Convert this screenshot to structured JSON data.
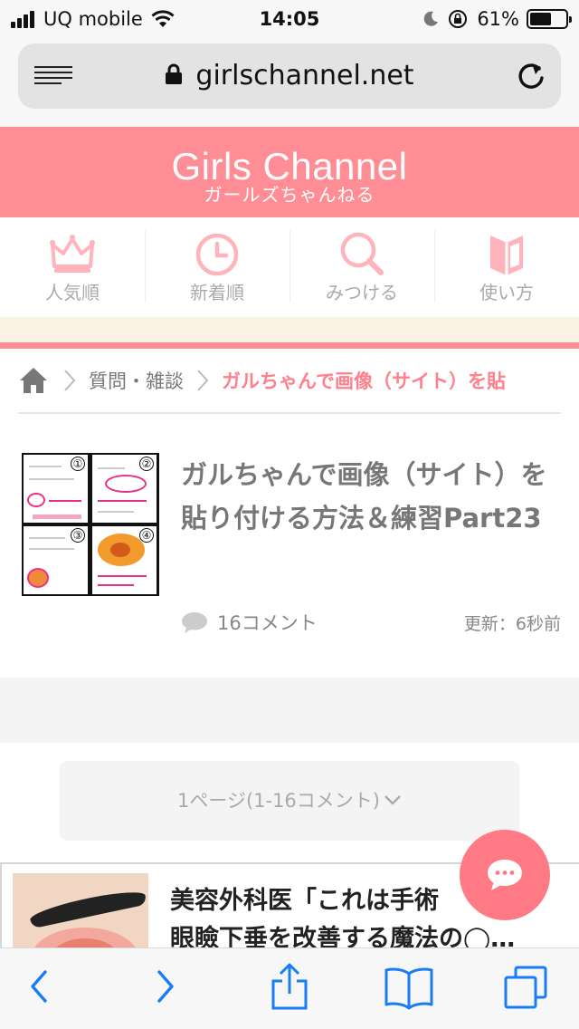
{
  "status_bar": {
    "carrier": "UQ mobile",
    "time": "14:05",
    "battery": "61%",
    "battery_level": 0.61
  },
  "browser": {
    "url": "girlschannel.net"
  },
  "site": {
    "logo": "Girls Channel",
    "logo_sub": "ガールズちゃんねる"
  },
  "nav": {
    "items": [
      {
        "label": "人気順",
        "icon": "crown-icon"
      },
      {
        "label": "新着順",
        "icon": "clock-icon"
      },
      {
        "label": "みつける",
        "icon": "search-icon"
      },
      {
        "label": "使い方",
        "icon": "book-icon"
      }
    ]
  },
  "breadcrumb": {
    "category": "質問・雑談",
    "current": "ガルちゃんで画像（サイト）を貼"
  },
  "article": {
    "title": "ガルちゃんで画像（サイト）を貼り付ける方法＆練習Part23",
    "comments": "16コメント",
    "updated": "更新：6秒前",
    "thumb_numbers": [
      "①",
      "②",
      "③",
      "④"
    ]
  },
  "pager": {
    "label": "1ページ(1-16コメント)"
  },
  "ad": {
    "title": "美容外科医「これは手術",
    "title_line2": "眼瞼下垂を改善する魔法の◯…"
  },
  "colors": {
    "brand": "#ff8d95",
    "accent_text": "#ff7f8b",
    "fab": "#ff7a84",
    "ios_blue": "#1a7cf5"
  }
}
